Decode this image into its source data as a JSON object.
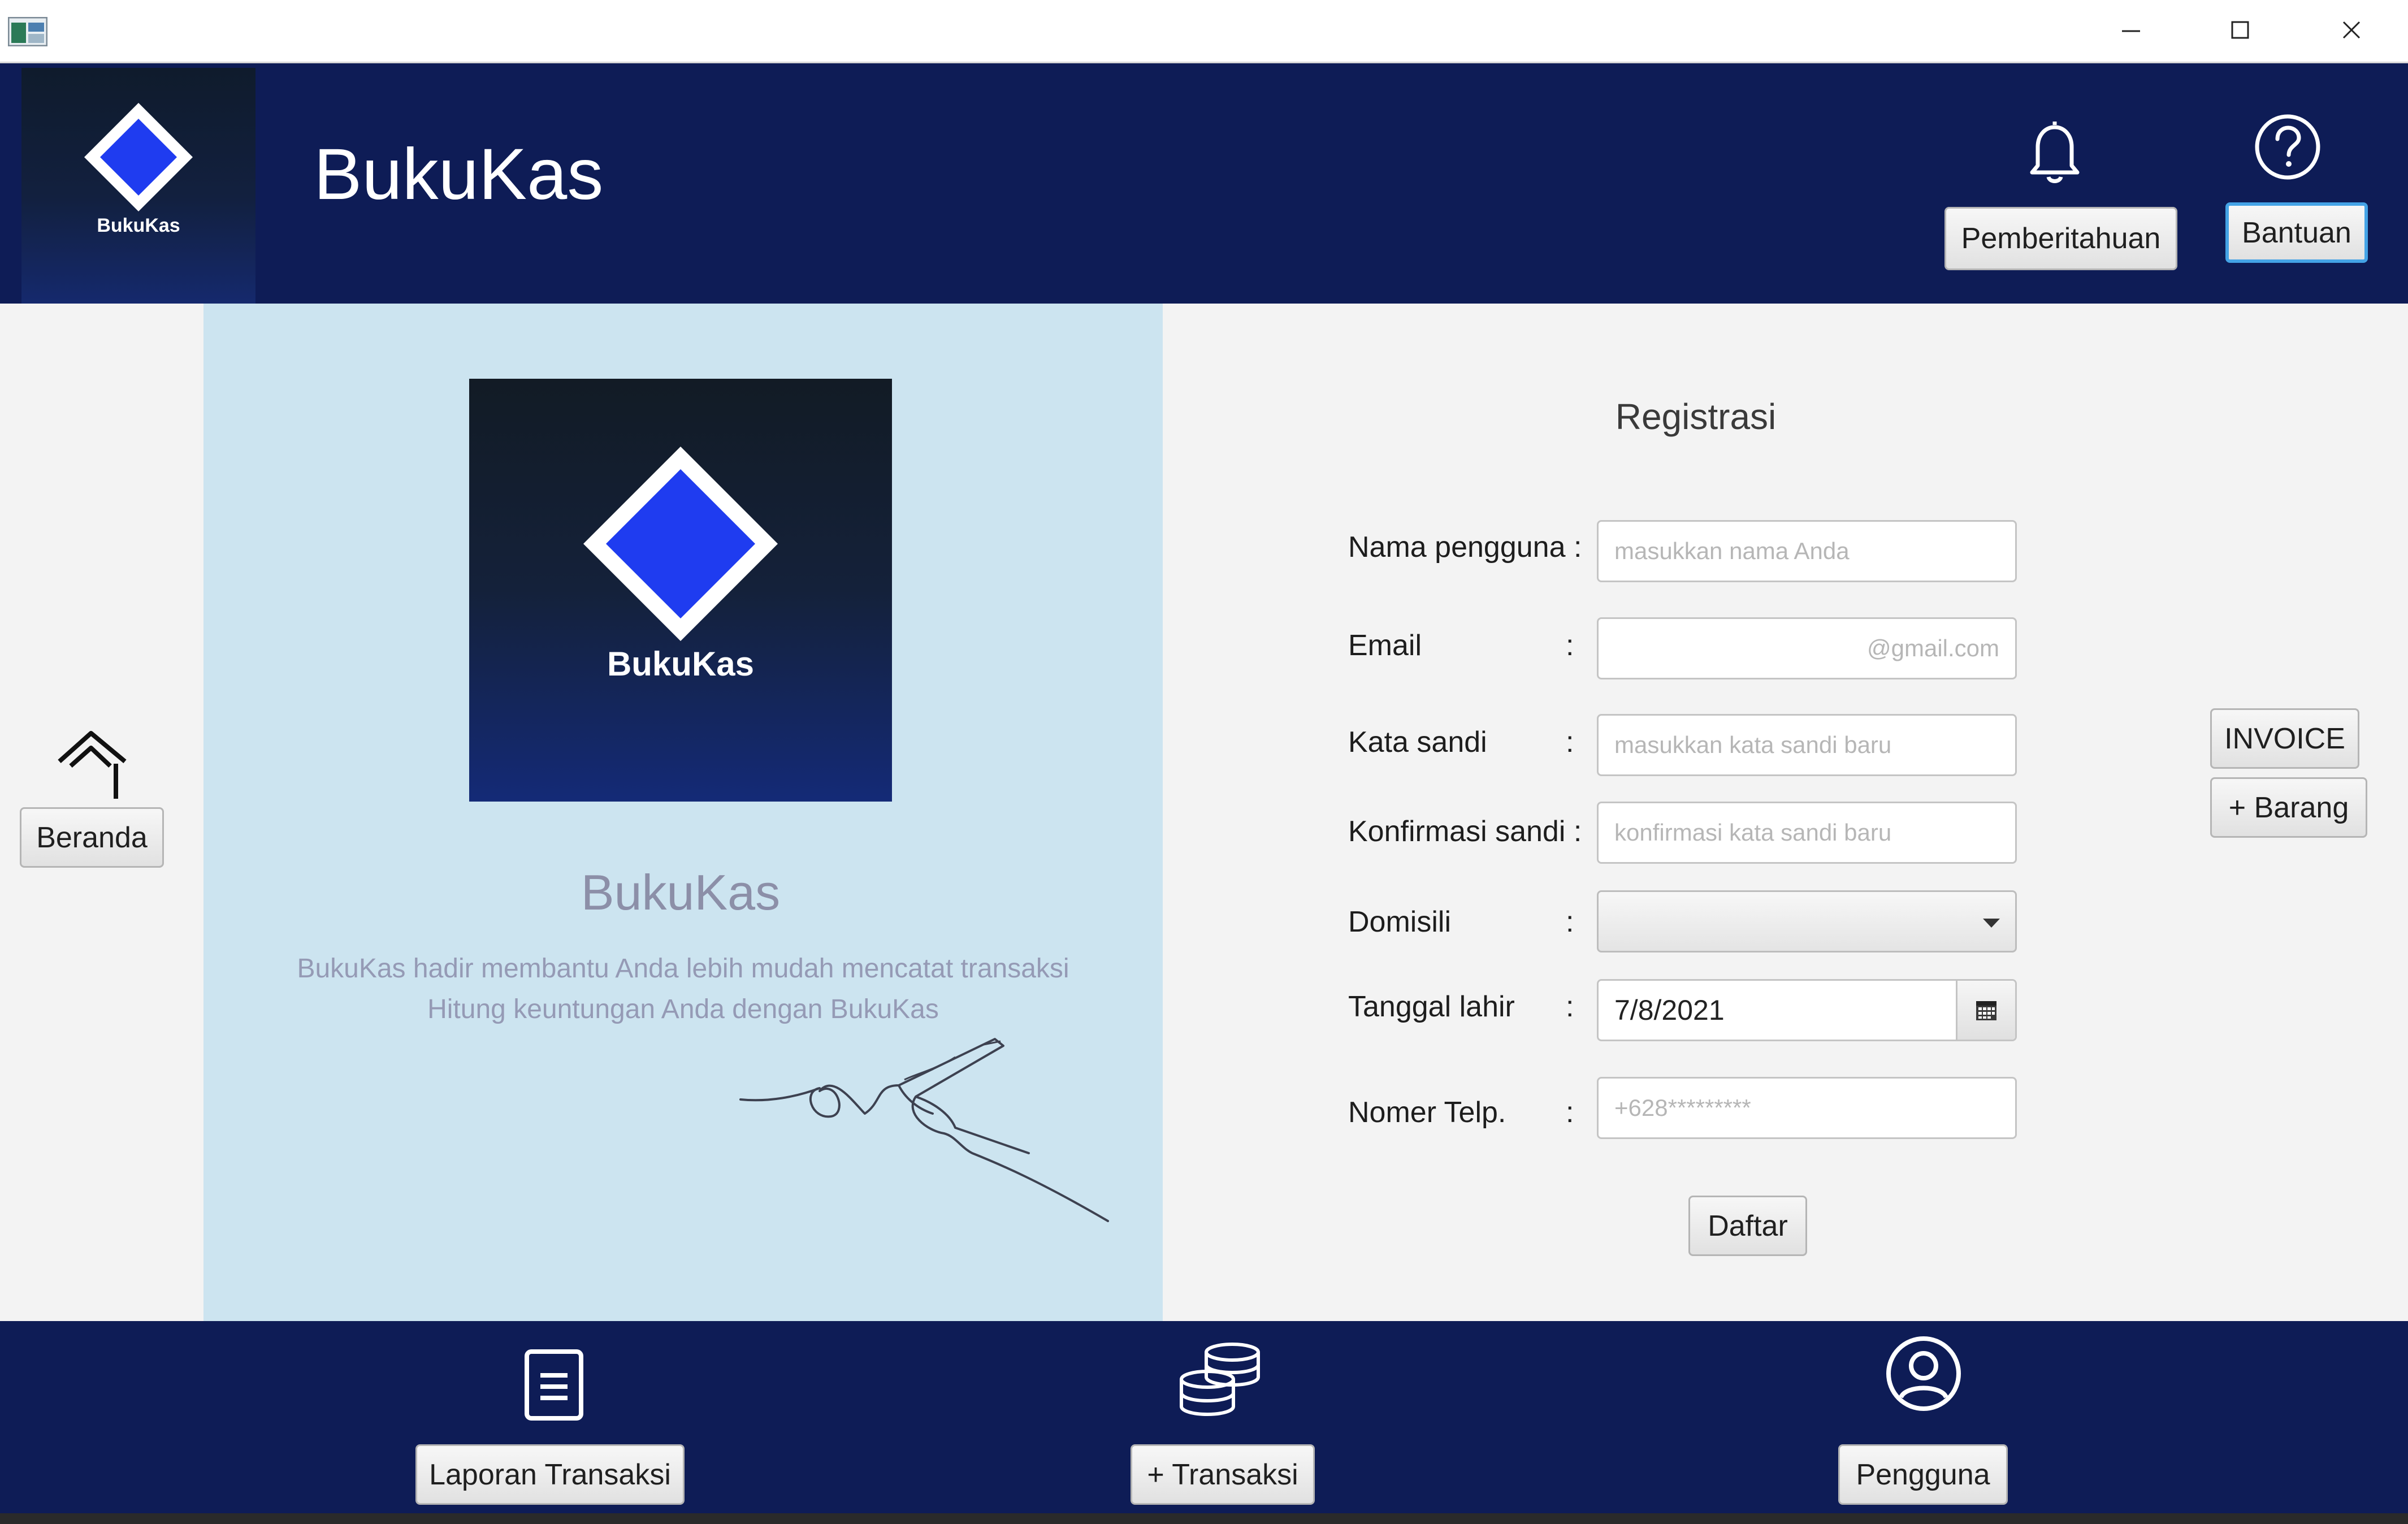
{
  "app": {
    "title": "BukuKas",
    "logo_text": "BukuKas"
  },
  "window_controls": {
    "minimize": "minimize",
    "maximize": "maximize",
    "close": "close"
  },
  "header": {
    "title": "BukuKas",
    "notifications_label": "Pemberitahuan",
    "help_label": "Bantuan"
  },
  "sidebar": {
    "home_label": "Beranda"
  },
  "hero": {
    "logo_text": "BukuKas",
    "title": "BukuKas",
    "tagline_line1": "BukuKas hadir membantu Anda lebih mudah mencatat transaksi",
    "tagline_line2": "Hitung keuntungan Anda dengan BukuKas"
  },
  "form": {
    "title": "Registrasi",
    "fields": {
      "username": {
        "label": "Nama pengguna :",
        "placeholder": "masukkan nama Anda",
        "value": ""
      },
      "email": {
        "label": "Email",
        "placeholder": "@gmail.com",
        "value": ""
      },
      "password": {
        "label": "Kata sandi",
        "placeholder": "masukkan kata sandi baru",
        "value": ""
      },
      "confirm": {
        "label": "Konfirmasi sandi :",
        "placeholder": "konfirmasi kata sandi baru",
        "value": ""
      },
      "domicile": {
        "label": "Domisili",
        "value": ""
      },
      "birthdate": {
        "label": "Tanggal lahir",
        "value": "7/8/2021"
      },
      "phone": {
        "label": "Nomer Telp.",
        "placeholder": "+628*********",
        "value": ""
      }
    },
    "colon": ":",
    "submit_label": "Daftar"
  },
  "side_actions": {
    "invoice_label": "INVOICE",
    "add_item_label": "+ Barang"
  },
  "bottom_nav": {
    "report_label": "Laporan Transaksi",
    "transaction_label": "+ Transaksi",
    "user_label": "Pengguna"
  },
  "colors": {
    "navy": "#0e1c56",
    "hero_bg": "#cce4f0",
    "diamond": "#1f3cf0",
    "help_border": "#44a3e6"
  }
}
